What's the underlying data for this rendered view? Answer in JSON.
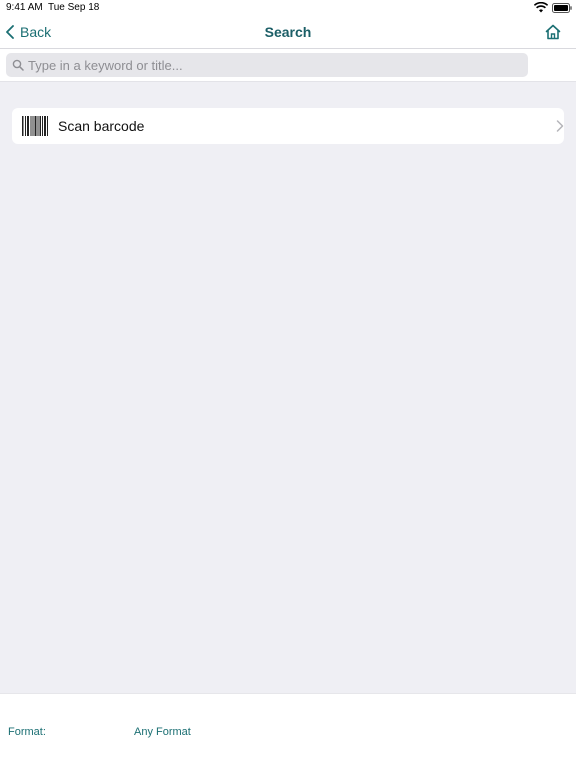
{
  "status_bar": {
    "time": "9:41 AM",
    "date": "Tue Sep 18",
    "icons": [
      "wifi-icon",
      "battery-icon"
    ]
  },
  "nav": {
    "back_label": "Back",
    "title": "Search",
    "icons": [
      "chevron-left-icon",
      "home-icon"
    ]
  },
  "search": {
    "placeholder": "Type in a keyword or title...",
    "value": "",
    "icon": "search-icon"
  },
  "scan": {
    "label": "Scan barcode",
    "icons": [
      "barcode-icon",
      "chevron-right-icon"
    ]
  },
  "bottom": {
    "format_label": "Format:",
    "format_value": "Any Format"
  },
  "colors": {
    "accent": "#1b6f73",
    "title": "#1b5e66",
    "background": "#efeff4"
  }
}
